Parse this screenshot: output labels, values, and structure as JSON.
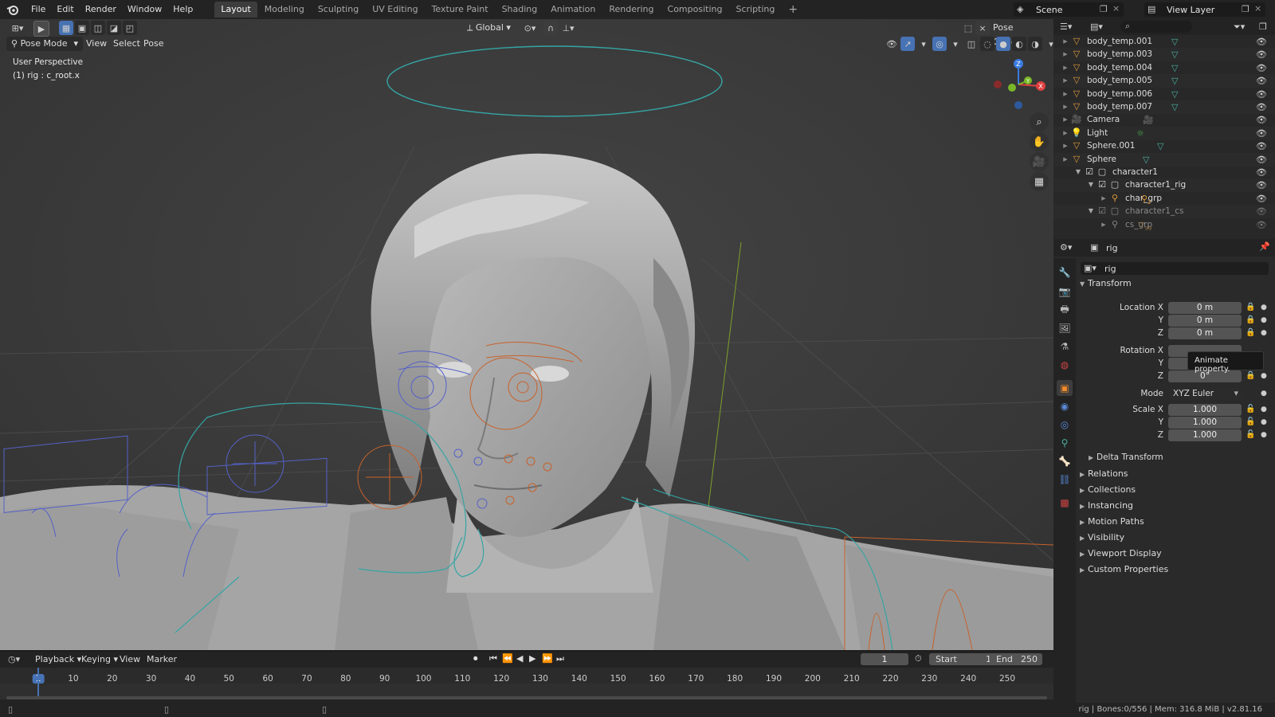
{
  "menu": {
    "items": [
      "File",
      "Edit",
      "Render",
      "Window",
      "Help"
    ]
  },
  "workspaces": [
    "Layout",
    "Modeling",
    "Sculpting",
    "UV Editing",
    "Texture Paint",
    "Shading",
    "Animation",
    "Rendering",
    "Compositing",
    "Scripting"
  ],
  "scene": {
    "name": "Scene",
    "view_layer": "View Layer"
  },
  "viewport": {
    "mode": "Pose Mode",
    "menus": [
      "View",
      "Select",
      "Pose"
    ],
    "transform_orientation": "Global",
    "pose_options": "Pose Options",
    "overlay_title": "User Perspective",
    "overlay_object": "(1) rig : c_root.x",
    "gizmo_axes": {
      "x": "X",
      "y": "Y",
      "z": "Z"
    }
  },
  "outliner": {
    "rows": [
      {
        "name": "body_temp.001",
        "icon": "mesh-icon"
      },
      {
        "name": "body_temp.003",
        "icon": "mesh-icon"
      },
      {
        "name": "body_temp.004",
        "icon": "mesh-icon"
      },
      {
        "name": "body_temp.005",
        "icon": "mesh-icon"
      },
      {
        "name": "body_temp.006",
        "icon": "mesh-icon"
      },
      {
        "name": "body_temp.007",
        "icon": "mesh-icon"
      },
      {
        "name": "Camera",
        "icon": "camera-icon"
      },
      {
        "name": "Light",
        "icon": "light-icon"
      },
      {
        "name": "Sphere.001",
        "icon": "mesh-icon"
      },
      {
        "name": "Sphere",
        "icon": "mesh-icon"
      },
      {
        "name": "character1",
        "icon": "collection-icon"
      },
      {
        "name": "character1_rig",
        "icon": "collection-icon"
      },
      {
        "name": "char_grp",
        "icon": "armature-icon"
      },
      {
        "name": "character1_cs",
        "icon": "collection-icon"
      },
      {
        "name": "cs_grp",
        "icon": "armature-icon"
      }
    ],
    "badge_char_grp": "2",
    "badge_cs_grp": "99"
  },
  "properties": {
    "object_name": "rig",
    "datablock_name": "rig",
    "transform_label": "Transform",
    "location_x_label": "Location X",
    "y_label": "Y",
    "z_label": "Z",
    "location": {
      "x": "0 m",
      "y": "0 m",
      "z": "0 m"
    },
    "rotation_x_label": "Rotation X",
    "rotation_z": "0°",
    "tooltip": "Animate property.",
    "mode_label": "Mode",
    "mode_value": "XYZ Euler",
    "scale_x_label": "Scale X",
    "scale": {
      "x": "1.000",
      "y": "1.000",
      "z": "1.000"
    },
    "sections": [
      "Delta Transform",
      "Relations",
      "Collections",
      "Instancing",
      "Motion Paths",
      "Visibility",
      "Viewport Display",
      "Custom Properties"
    ]
  },
  "timeline": {
    "menus": [
      "Playback",
      "Keying",
      "View",
      "Marker"
    ],
    "current_frame": "1",
    "start_label": "Start",
    "start": "1",
    "end_label": "End",
    "end": "250",
    "ruler": [
      "1",
      "10",
      "20",
      "30",
      "40",
      "50",
      "60",
      "70",
      "80",
      "90",
      "100",
      "110",
      "120",
      "130",
      "140",
      "150",
      "160",
      "170",
      "180",
      "190",
      "200",
      "210",
      "220",
      "230",
      "240",
      "250"
    ]
  },
  "status": {
    "text": "rig | Bones:0/556 | Mem: 316.8 MiB | v2.81.16"
  },
  "colors": {
    "accent": "#4772b3",
    "bone_orange": "#c8612a",
    "bone_blue": "#5561c8",
    "control_teal": "#36a5a5"
  }
}
